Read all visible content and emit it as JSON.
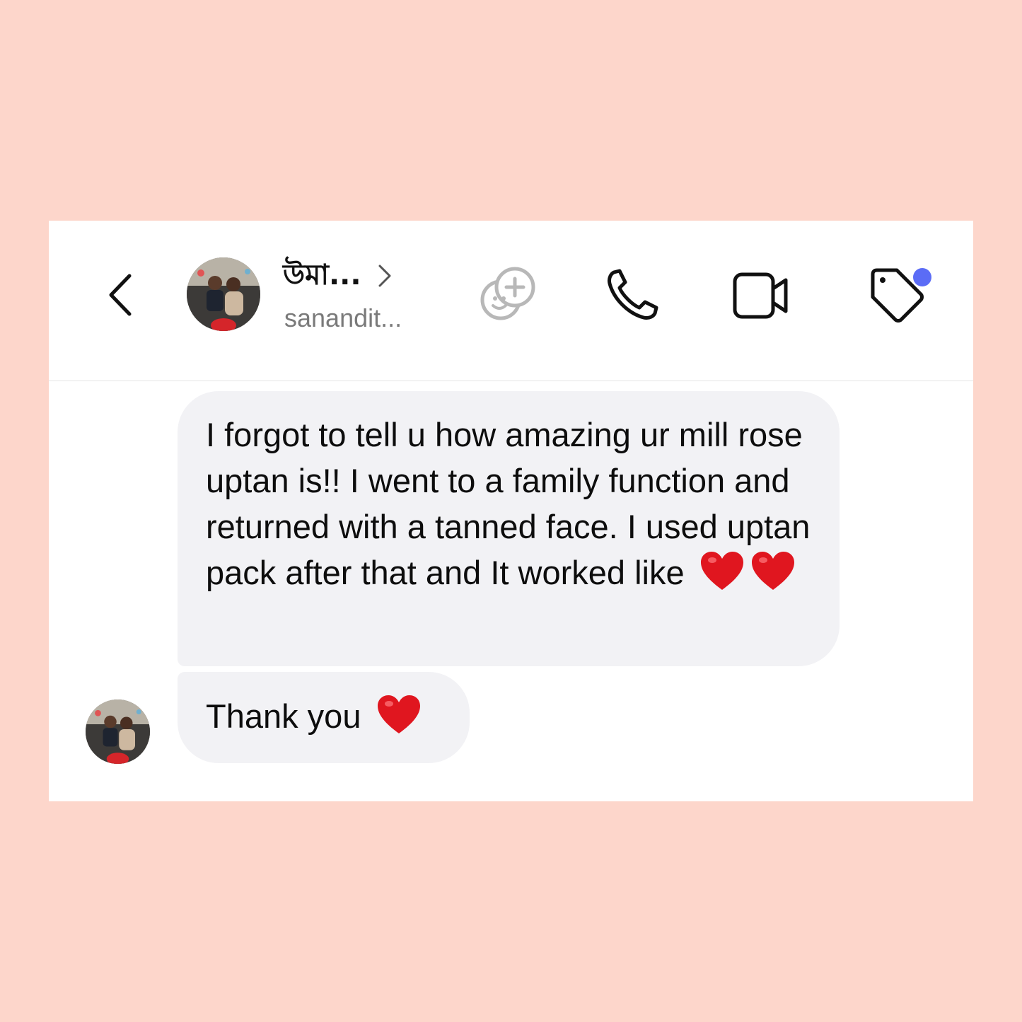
{
  "header": {
    "contact_name": "উমা...",
    "username": "sanandit...",
    "icons": {
      "back": "chevron-left-icon",
      "profile_chevron": "chevron-right-icon",
      "add_effect": "sticker-add-icon",
      "call": "phone-icon",
      "video": "video-camera-icon",
      "tag": "tag-icon"
    },
    "notification_dot_color": "#5b6cf6"
  },
  "messages": [
    {
      "text": "I forgot to tell u how amazing ur mill rose uptan is!! I went to a family function and returned with a tanned face. I used uptan pack after that and It worked like",
      "emoji": [
        "red-heart",
        "red-heart"
      ]
    },
    {
      "text": "Thank you",
      "emoji": [
        "red-heart"
      ]
    }
  ],
  "colors": {
    "page_background": "#fdd6cb",
    "card_background": "#ffffff",
    "bubble_background": "#f2f2f5",
    "heart": "#e0161f"
  }
}
